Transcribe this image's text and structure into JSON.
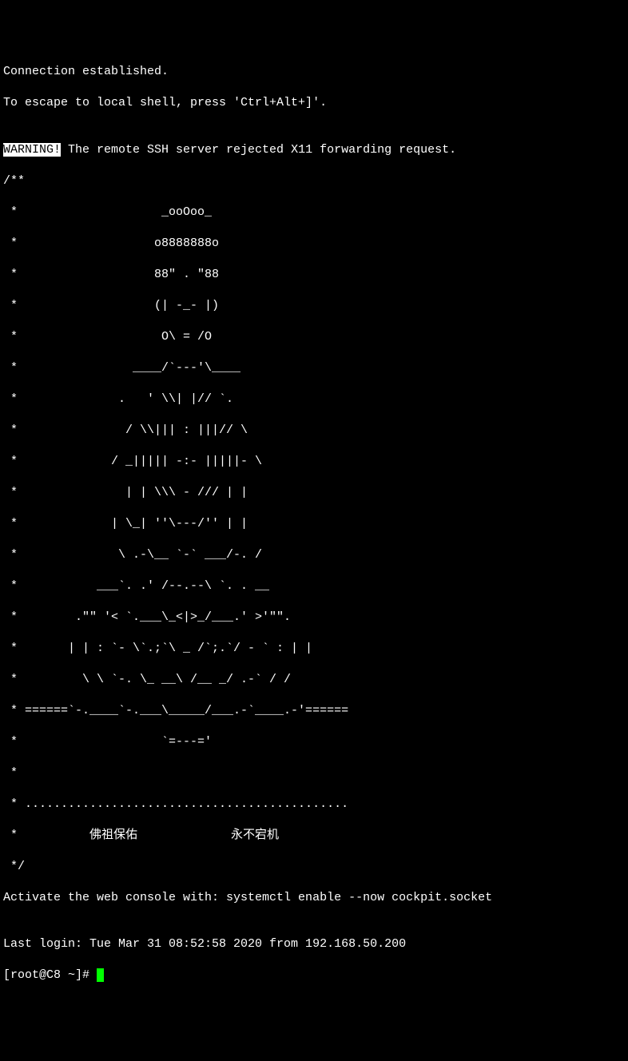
{
  "line1": "Connection established.",
  "line2": "To escape to local shell, press 'Ctrl+Alt+]'.",
  "blank1": "",
  "warning_label": "WARNING!",
  "warning_text": " The remote SSH server rejected X11 forwarding request.",
  "ascii": {
    "l0": "/**",
    "l1": " *                    _ooOoo_",
    "l2": " *                   o8888888o",
    "l3": " *                   88\" . \"88",
    "l4": " *                   (| -_- |)",
    "l5": " *                    O\\ = /O",
    "l6": " *                ____/`---'\\____",
    "l7": " *              .   ' \\\\| |// `.",
    "l8": " *               / \\\\||| : |||// \\",
    "l9": " *             / _||||| -:- |||||- \\",
    "l10": " *               | | \\\\\\ - /// | |",
    "l11": " *             | \\_| ''\\---/'' | |",
    "l12": " *              \\ .-\\__ `-` ___/-. /",
    "l13": " *           ___`. .' /--.--\\ `. . __",
    "l14": " *        .\"\" '< `.___\\_<|>_/___.' >'\"\".",
    "l15": " *       | | : `- \\`.;`\\ _ /`;.`/ - ` : | |",
    "l16": " *         \\ \\ `-. \\_ __\\ /__ _/ .-` / /",
    "l17": " * ======`-.____`-.___\\_____/___.-`____.-'======",
    "l18": " *                    `=---='",
    "l19": " *",
    "l20": " * .............................................",
    "l21": " *          佛祖保佑             永不宕机",
    "l22": " */"
  },
  "activate": "Activate the web console with: systemctl enable --now cockpit.socket",
  "blank2": "",
  "last_login": "Last login: Tue Mar 31 08:52:58 2020 from 192.168.50.200",
  "prompt": "[root@C8 ~]# "
}
